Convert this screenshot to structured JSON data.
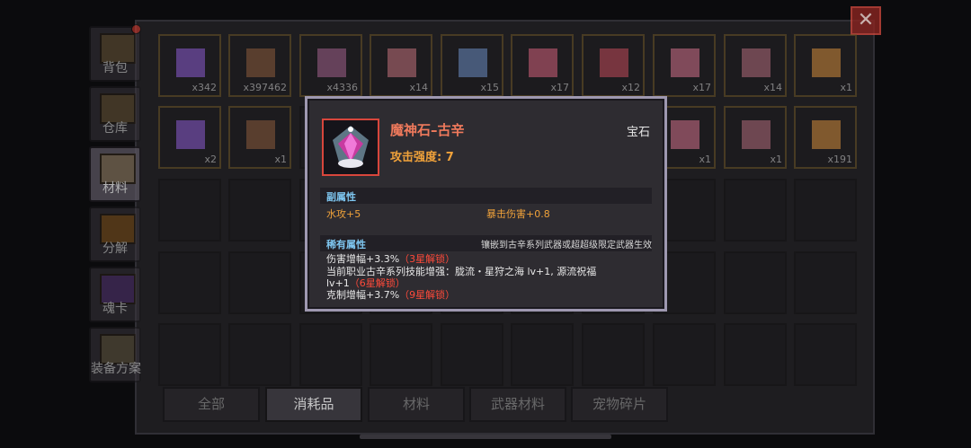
{
  "side_tabs": [
    {
      "label": "背包",
      "has_dot": true
    },
    {
      "label": "仓库"
    },
    {
      "label": "材料"
    },
    {
      "label": "分解"
    },
    {
      "label": "魂卡"
    },
    {
      "label": "装备方案"
    }
  ],
  "close_label": "✕",
  "slots_row1": [
    "x342",
    "x397462",
    "x4336",
    "x14",
    "x15",
    "x17",
    "x12",
    "x17",
    "x14",
    "x1"
  ],
  "slots_row2": [
    "x2",
    "x1",
    "",
    "",
    "",
    "",
    "",
    "x1",
    "x1",
    "x191"
  ],
  "filter_tabs": [
    "全部",
    "消耗品",
    "材料",
    "武器材料",
    "宠物碎片"
  ],
  "active_filter": "消耗品",
  "tooltip": {
    "name": "魔神石–古辛",
    "type": "宝石",
    "attack_label": "攻击强度: 7",
    "sub_attr_title": "副属性",
    "sub_attr_1": "水攻+5",
    "sub_attr_2": "暴击伤害+0.8",
    "rare_attr_title": "稀有属性",
    "rare_note": "镶嵌到古辛系列武器或超超级限定武器生效",
    "line1_text": "伤害增幅+3.3%",
    "line1_lock": "（3星解锁）",
    "line2_text": "当前职业古辛系列技能增强：胧流・星狩之海 lv+1, 源流祝福",
    "line3_text": "lv+1",
    "line3_lock": "（6星解锁）",
    "line4_text": "克制增幅+3.7%",
    "line4_lock": "（9星解锁）"
  },
  "colors": {
    "item_name": "#f07a5c",
    "attack": "#f0a23a",
    "section_title": "#7ec6f0",
    "lock": "#ff4a3a",
    "slot_border": "#6b5526"
  }
}
